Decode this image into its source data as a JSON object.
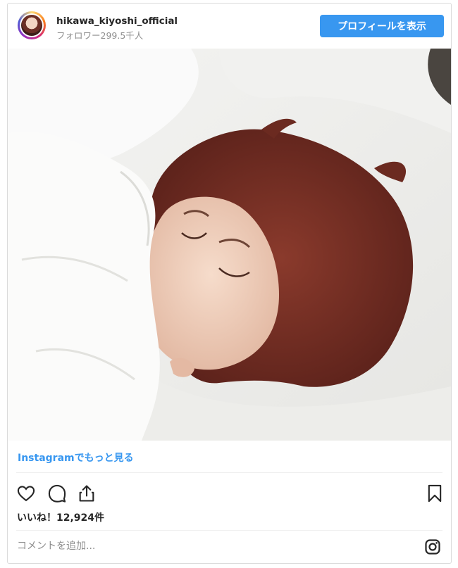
{
  "header": {
    "username": "hikawa_kiyoshi_official",
    "followers": "フォロワー299.5千人",
    "profile_button": "プロフィールを表示"
  },
  "post": {
    "more_link": "Instagramでもっと見る",
    "likes": "いいね！12,924件",
    "comment_placeholder": "コメントを追加..."
  },
  "icons": [
    "heart-icon",
    "comment-icon",
    "share-icon",
    "bookmark-icon",
    "instagram-icon"
  ],
  "colors": {
    "accent": "#3897f0",
    "text": "#262626",
    "muted": "#8e8e8e",
    "border": "#dbdbdb"
  }
}
